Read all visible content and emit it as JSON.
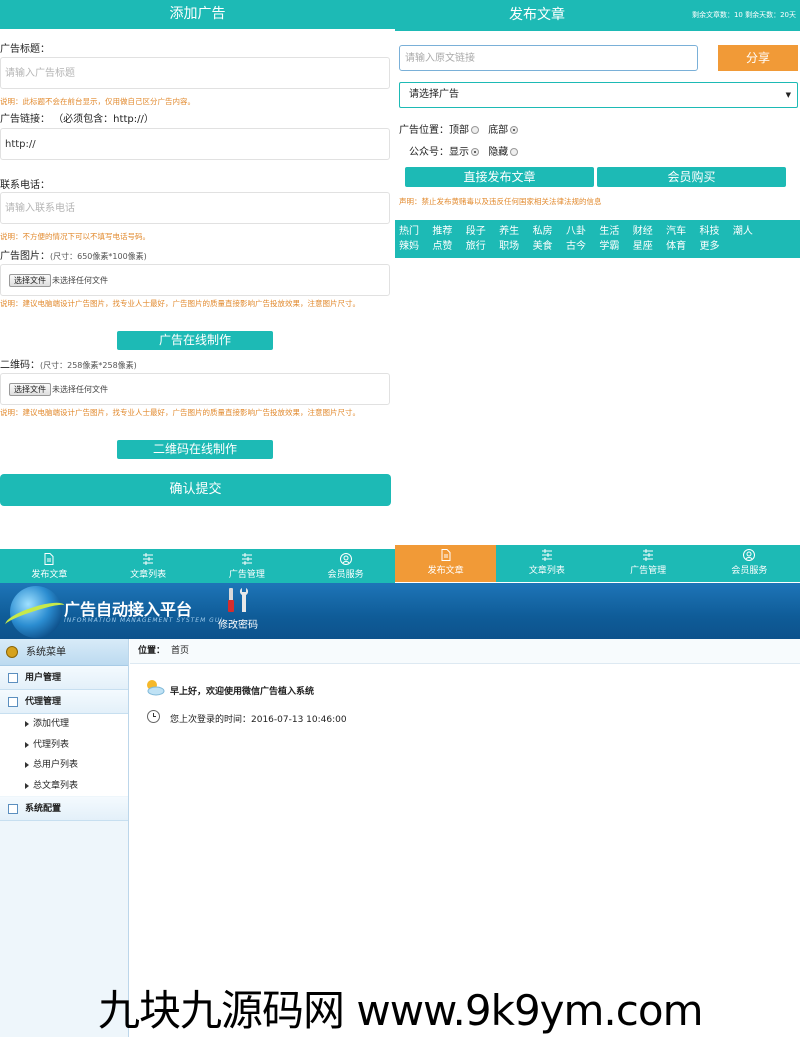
{
  "add_ad": {
    "title": "添加广告",
    "ad_title_label": "广告标题：",
    "ad_title_placeholder": "请输入广告标题",
    "ad_title_note": "说明：此标题不会在前台显示，仅用做自己区分广告内容。",
    "link_label": "广告链接：",
    "link_hint": "（必须包含：http://）",
    "link_value": "http://",
    "phone_label": "联系电话：",
    "phone_placeholder": "请输入联系电话",
    "phone_note": "说明：不方便的情况下可以不填写电话号码。",
    "image_label": "广告图片：",
    "image_size": "(尺寸：650像素*100像素)",
    "choose_file": "选择文件",
    "no_file": "未选择任何文件",
    "image_note": "说明：建议电脑端设计广告图片，找专业人士最好，广告图片的质量直接影响广告投放效果，注意图片尺寸。",
    "make_ad_online": "广告在线制作",
    "qr_label": "二维码：",
    "qr_size": "(尺寸：258像素*258像素)",
    "qr_note": "说明：建议电脑端设计广告图片，找专业人士最好，广告图片的质量直接影响广告投放效果，注意图片尺寸。",
    "make_qr_online": "二维码在线制作",
    "submit": "确认提交"
  },
  "tabs": [
    "发布文章",
    "文章列表",
    "广告管理",
    "会员服务"
  ],
  "publish": {
    "title": "发布文章",
    "quota": "剩余文章数：10  剩余天数：20天",
    "link_placeholder": "请输入原文链接",
    "share": "分享",
    "select_ad": "请选择广告",
    "position_label": "广告位置：",
    "pos_top": "顶部",
    "pos_bottom": "底部",
    "account_label": "公众号：",
    "show": "显示",
    "hide": "隐藏",
    "direct_publish": "直接发布文章",
    "member_buy": "会员购买",
    "notice": "声明：禁止发布黄赌毒以及违反任何国家相关法律法规的信息",
    "categories": [
      "热门",
      "推荐",
      "段子",
      "养生",
      "私房",
      "八卦",
      "生活",
      "财经",
      "汽车",
      "科技",
      "潮人",
      "辣妈",
      "点赞",
      "旅行",
      "职场",
      "美食",
      "古今",
      "学霸",
      "星座",
      "体育",
      "更多"
    ]
  },
  "admin": {
    "system_title": "广告自动接入平台",
    "system_subtitle": "INFORMATION MANAGEMENT SYSTEM GUI",
    "change_password": "修改密码",
    "menu_title": "系统菜单",
    "menu": {
      "user_mgmt": "用户管理",
      "agent_mgmt": "代理管理",
      "add_agent": "添加代理",
      "agent_list": "代理列表",
      "all_users": "总用户列表",
      "all_articles": "总文章列表",
      "sys_config": "系统配置"
    },
    "crumb_label": "位置：",
    "crumb_page": "首页",
    "welcome": "早上好，欢迎使用微信广告植入系统",
    "last_login": "您上次登录的时间：2016-07-13 10:46:00"
  },
  "watermark": "九块九源码网 www.9k9ym.com",
  "colors": {
    "teal": "#1dbab5",
    "orange": "#f19a37",
    "note": "#e28a2e",
    "admin_blue": "#0f5c98"
  }
}
